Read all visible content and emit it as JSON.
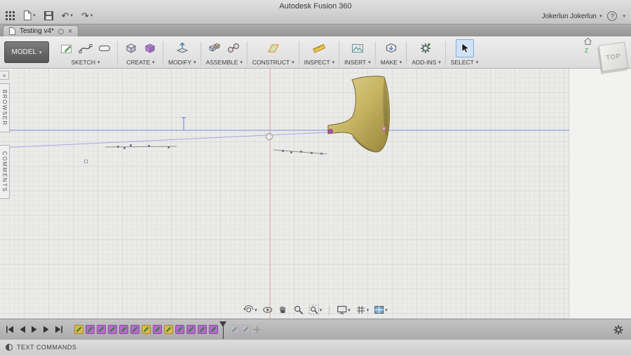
{
  "window": {
    "title": "Autodesk Fusion 360"
  },
  "titlebar": {
    "user": "Jokerlun Jokerlun",
    "help_label": "?",
    "icons": [
      "app-grid-icon",
      "file-icon",
      "save-icon",
      "undo-icon",
      "redo-icon"
    ]
  },
  "tabbar": {
    "active_tab": "Testing v4*"
  },
  "toolbar": {
    "model_label": "MODEL",
    "groups": [
      {
        "label": "SKETCH"
      },
      {
        "label": "CREATE"
      },
      {
        "label": "MODIFY"
      },
      {
        "label": "ASSEMBLE"
      },
      {
        "label": "CONSTRUCT"
      },
      {
        "label": "INSPECT"
      },
      {
        "label": "INSERT"
      },
      {
        "label": "MAKE"
      },
      {
        "label": "ADD-INS"
      },
      {
        "label": "SELECT"
      }
    ]
  },
  "side_panels": {
    "browser": "BROWSER",
    "comments": "COMMENTS",
    "expand_glyph": "»"
  },
  "viewcube": {
    "face": "TOP",
    "axis": "Z"
  },
  "canvas": {
    "colors": {
      "horn_light": "#e3d693",
      "horn_mid": "#c6b463",
      "horn_dark": "#96843a",
      "horn_outline": "#756728",
      "axis_red": "#efadad",
      "sketch_blue": "#959cdb",
      "point_purple": "#b352b8",
      "point_pink": "#eaa4d2",
      "select_highlight": "#cfe2f6"
    },
    "sketch_points": [
      [
        168,
        111
      ],
      [
        177,
        113
      ],
      [
        186,
        109
      ],
      [
        212,
        110
      ],
      [
        240,
        112
      ],
      [
        403,
        117
      ],
      [
        415,
        119
      ],
      [
        429,
        118
      ],
      [
        444,
        120
      ],
      [
        458,
        121
      ]
    ],
    "origin_point": [
      385,
      98
    ],
    "selected_point": [
      472,
      90
    ],
    "pink_point": [
      548,
      86
    ],
    "open_point": [
      123,
      133
    ]
  },
  "nav_toolbar": {
    "icons": [
      "orbit-icon",
      "look-at-icon",
      "pan-icon",
      "zoom-icon",
      "fit-icon",
      "display-settings-icon",
      "grid-snaps-icon",
      "viewports-icon"
    ]
  },
  "timeline": {
    "playback": [
      "skip-start",
      "step-back",
      "play",
      "step-forward",
      "skip-end"
    ],
    "items": [
      "gold",
      "sketch",
      "sketch",
      "sketch",
      "sketch",
      "sketch",
      "gold",
      "sketch",
      "gold",
      "sketch",
      "sketch",
      "sketch",
      "sketch"
    ],
    "ghost_items": [
      "sketch-ghost",
      "sketch-ghost",
      "move-ghost"
    ]
  },
  "statusbar": {
    "label": "TEXT COMMANDS"
  }
}
